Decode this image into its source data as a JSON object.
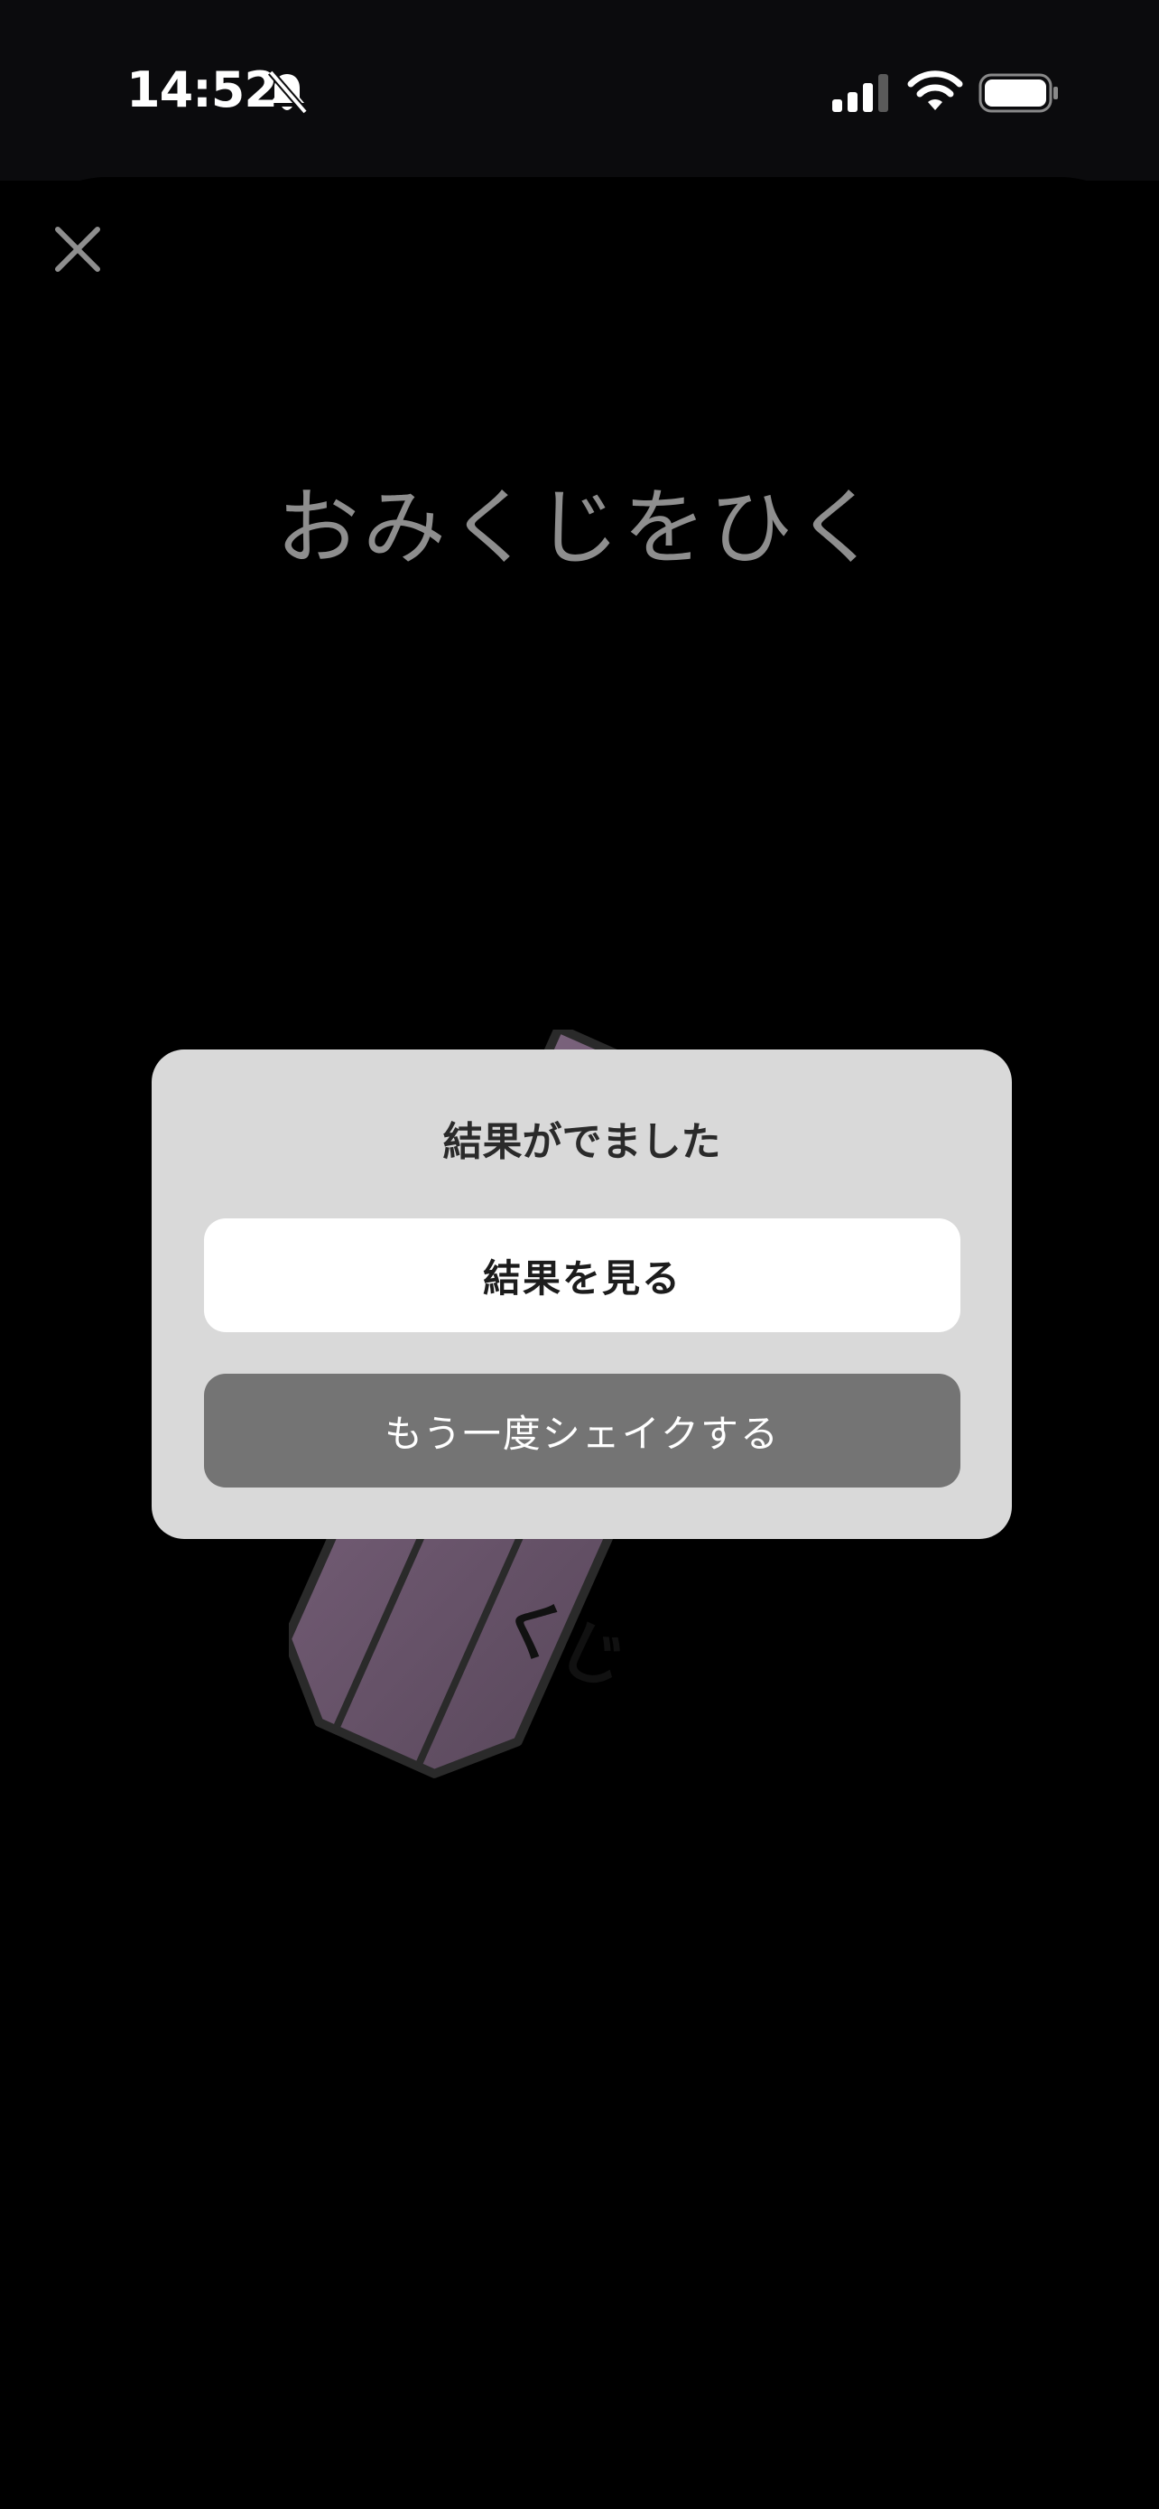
{
  "status_bar": {
    "time": "14:52",
    "icons": [
      "bell-slash-icon",
      "cellular-signal-icon",
      "wifi-icon",
      "battery-icon"
    ]
  },
  "header": {
    "close_icon": "close-icon",
    "title": "おみくじをひく"
  },
  "illustration": {
    "name": "omikuji-box",
    "text": "くじ",
    "colors": {
      "box": "#6e5a70",
      "outline": "#2a2a2a"
    }
  },
  "dialog": {
    "title": "結果がでました",
    "primary_button": "結果を見る",
    "secondary_button": "もう一度シェイクする"
  },
  "colors": {
    "background": "#000000",
    "dialog_background": "#d9d9d9",
    "primary_button_bg": "#ffffff",
    "secondary_button_bg": "#747474",
    "title_text": "#8e8e8e"
  }
}
